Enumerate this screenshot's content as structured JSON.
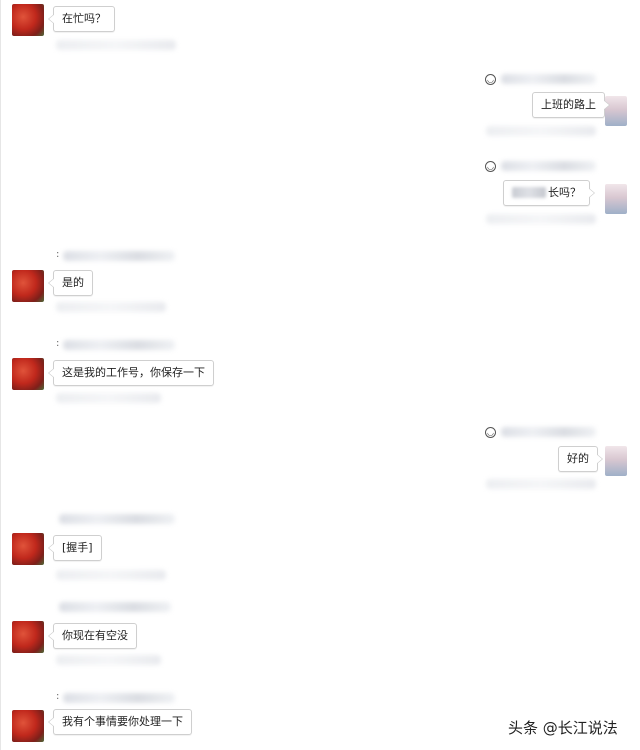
{
  "messages": [
    {
      "side": "left",
      "text": "在忙吗？"
    },
    {
      "side": "right",
      "text": "上班的路上"
    },
    {
      "side": "right",
      "text": "长吗？"
    },
    {
      "side": "left",
      "text": "是的"
    },
    {
      "side": "left",
      "text": "这是我的工作号，你保存一下"
    },
    {
      "side": "right",
      "text": "好的"
    },
    {
      "side": "left",
      "text": "[握手]"
    },
    {
      "side": "left",
      "text": "你现在有空没"
    },
    {
      "side": "left",
      "text": "我有个事情要你处理一下"
    }
  ],
  "watermark": "头条 @长江说法"
}
